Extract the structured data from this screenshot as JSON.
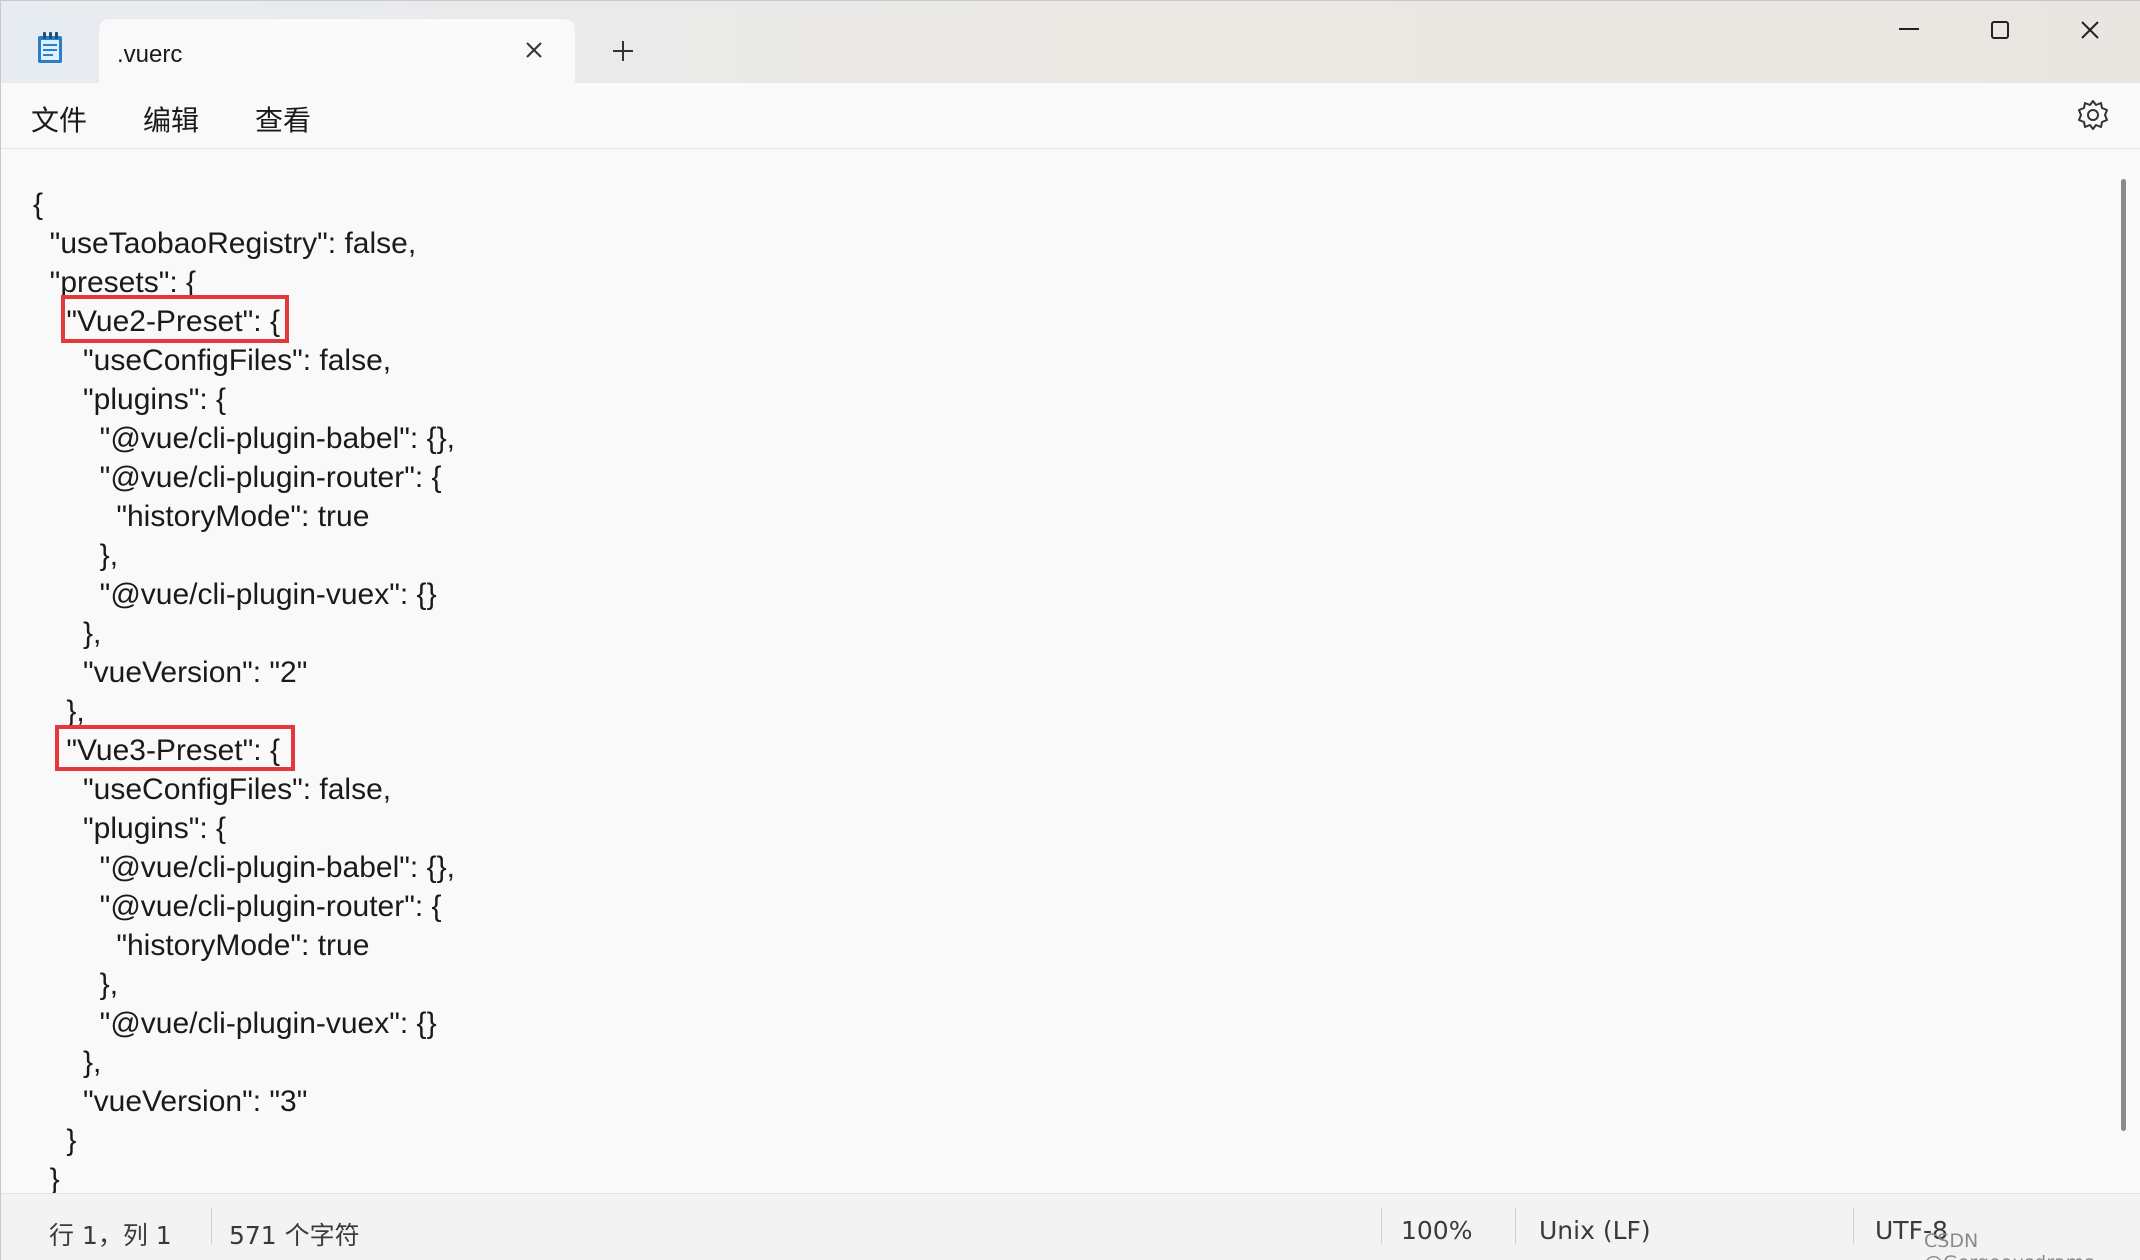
{
  "tab": {
    "title": ".vuerc"
  },
  "menu": {
    "file": "文件",
    "edit": "编辑",
    "view": "查看"
  },
  "editor": {
    "lines": [
      "{",
      "  \"useTaobaoRegistry\": false,",
      "  \"presets\": {",
      "    \"Vue2-Preset\": {",
      "      \"useConfigFiles\": false,",
      "      \"plugins\": {",
      "        \"@vue/cli-plugin-babel\": {},",
      "        \"@vue/cli-plugin-router\": {",
      "          \"historyMode\": true",
      "        },",
      "        \"@vue/cli-plugin-vuex\": {}",
      "      },",
      "      \"vueVersion\": \"2\"",
      "    },",
      "    \"Vue3-Preset\": {",
      "      \"useConfigFiles\": false,",
      "      \"plugins\": {",
      "        \"@vue/cli-plugin-babel\": {},",
      "        \"@vue/cli-plugin-router\": {",
      "          \"historyMode\": true",
      "        },",
      "        \"@vue/cli-plugin-vuex\": {}",
      "      },",
      "      \"vueVersion\": \"3\"",
      "    }",
      "  }"
    ]
  },
  "status": {
    "position": "行 1，列 1",
    "chars": "571 个字符",
    "zoom": "100%",
    "eol": "Unix (LF)",
    "encoding": "UTF-8"
  },
  "watermark": "CSDN @Gorgeousdrama",
  "colors": {
    "highlight": "#e3383c",
    "background": "#f9f9f9"
  },
  "icons": {
    "app": "notepad-icon",
    "close": "close-icon",
    "add": "plus-icon",
    "settings": "gear-icon"
  }
}
